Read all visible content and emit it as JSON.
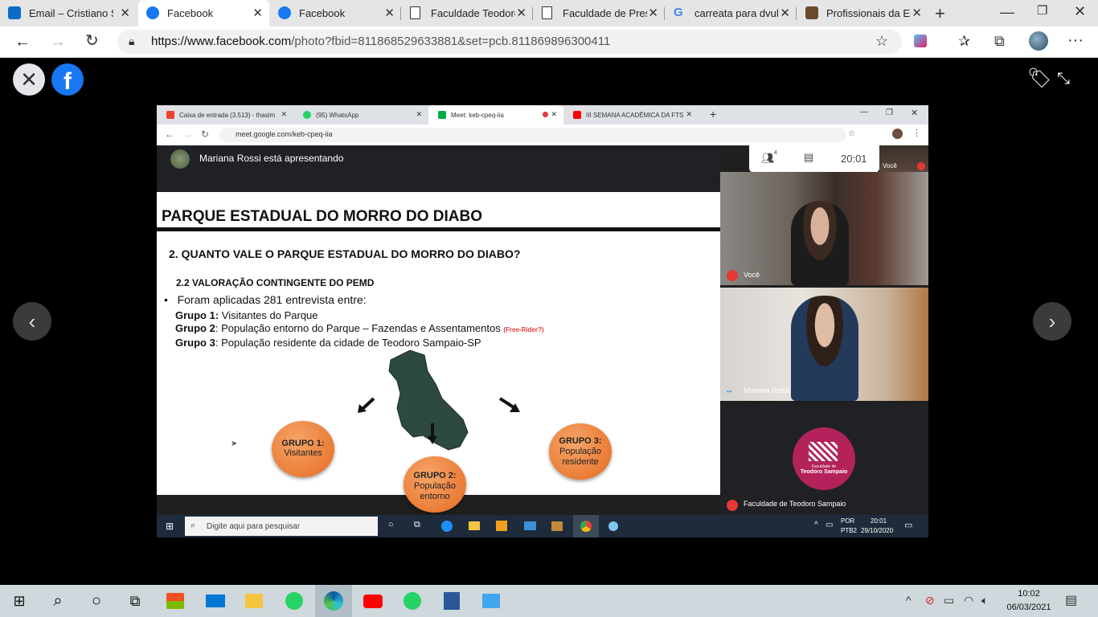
{
  "browser": {
    "tabs": [
      {
        "label": "Email – Cristiano S",
        "icon": "outlook-icon",
        "color": "#0a6cc8"
      },
      {
        "label": "Facebook",
        "icon": "facebook-icon",
        "color": "#1877f2"
      },
      {
        "label": "Facebook",
        "icon": "facebook-icon",
        "color": "#1877f2"
      },
      {
        "label": "Faculdade Teodoro",
        "icon": "page-icon",
        "color": "#ffffff"
      },
      {
        "label": "Faculdade de Pres",
        "icon": "page-icon",
        "color": "#ffffff"
      },
      {
        "label": "carreata para dvulg",
        "icon": "google-icon",
        "color": "#ffffff"
      },
      {
        "label": "Profissionais da En",
        "icon": "site-icon",
        "color": "#6b4a2a"
      }
    ],
    "url_prefix": "https://www.facebook.com",
    "url_rest": "/photo?fbid=811868529633881&set=pcb.811869896300411"
  },
  "inner": {
    "tabs": [
      {
        "label": "Caixa de entrada (3.513) - thasim",
        "icon": "gmail-icon",
        "color": "#ea4335"
      },
      {
        "label": "(95) WhatsApp",
        "icon": "whatsapp-icon",
        "color": "#25d366"
      },
      {
        "label": "Meet: keb-cpeq-iia",
        "icon": "meet-icon",
        "color": "#00ac47"
      },
      {
        "label": "III SEMANA ACADÊMICA DA FTS",
        "icon": "youtube-icon",
        "color": "#ff0000"
      }
    ],
    "url": "meet.google.com/keb-cpeq-iia",
    "presenter": "Mariana Rossi está apresentando",
    "participants_count": "4",
    "time": "20:01",
    "self_thumb_label": "Você",
    "tile1_name": "Você",
    "tile2_name": "Mariana Rossi",
    "tile3_name": "Faculdade de Teodoro Sampaio",
    "logo_text_line1": "Faculdade de",
    "logo_text_line2": "Teodoro Sampaio",
    "search_placeholder": "Digite aqui para pesquisar",
    "lang1": "POR",
    "lang2": "PTB2",
    "taskbar_time": "20:01",
    "taskbar_date": "29/10/2020"
  },
  "slide": {
    "title": "PARQUE ESTADUAL DO MORRO DO DIABO",
    "heading": "2. QUANTO VALE O PARQUE ESTADUAL DO MORRO DO DIABO?",
    "subheading": "2.2 VALORAÇÃO CONTINGENTE DO PEMD",
    "bullet": "Foram aplicadas 281 entrevista entre:",
    "g1_bold": "Grupo 1:",
    "g1_text": " Visitantes do Parque",
    "g2_bold": "Grupo 2",
    "g2_text": ": População entorno do Parque – Fazendas e Assentamentos",
    "g2_note": "(Free-Rider?)",
    "g3_bold": "Grupo 3",
    "g3_text": ": População residente da cidade de Teodoro Sampaio-SP",
    "c1_title": "GRUPO 1:",
    "c1_line": "Visitantes",
    "c2_title": "GRUPO 2:",
    "c2_line1": "População",
    "c2_line2": "entorno",
    "c3_title": "GRUPO 3:",
    "c3_line1": "População",
    "c3_line2": "residente"
  },
  "taskbar": {
    "time": "10:02",
    "date": "06/03/2021"
  }
}
